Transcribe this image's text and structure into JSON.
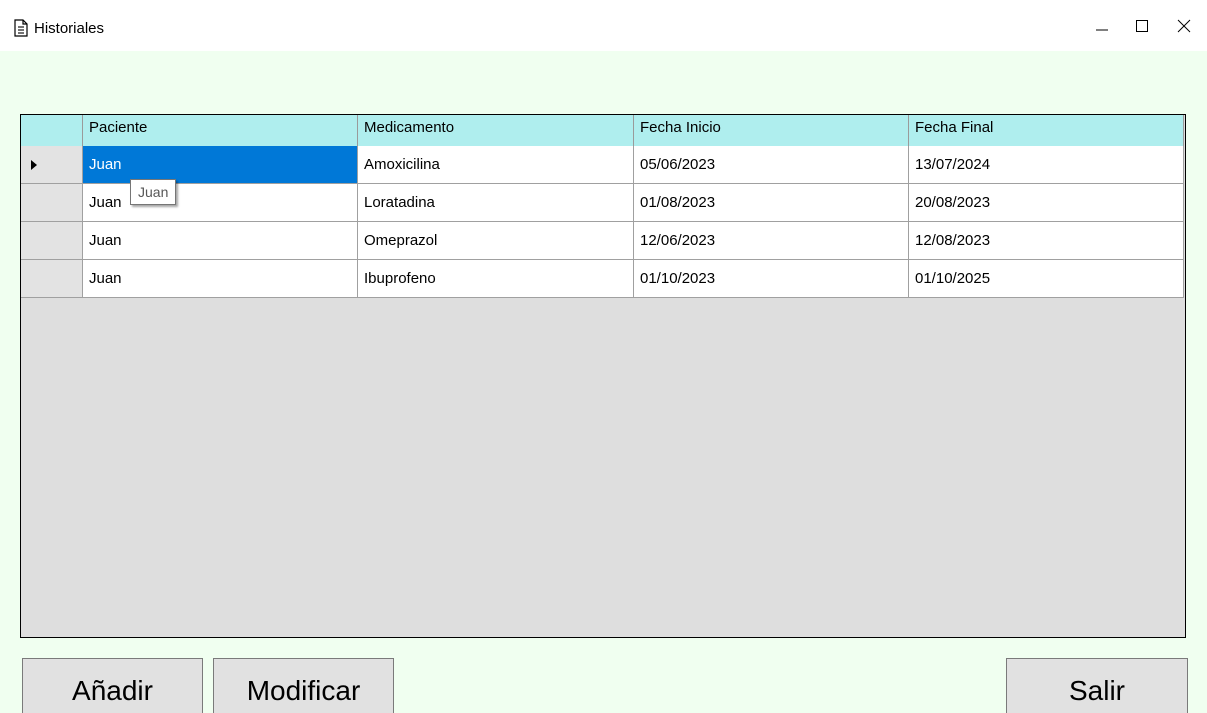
{
  "window": {
    "title": "Historiales",
    "app_icon": "document-icon",
    "controls": [
      "minimize-icon",
      "maximize-icon",
      "close-icon"
    ]
  },
  "grid": {
    "columns": [
      "Paciente",
      "Medicamento",
      "Fecha Inicio",
      "Fecha Final"
    ],
    "rows": [
      [
        "Juan",
        "Amoxicilina",
        "05/06/2023",
        "13/07/2024"
      ],
      [
        "Juan",
        "Loratadina",
        "01/08/2023",
        "20/08/2023"
      ],
      [
        "Juan",
        "Omeprazol",
        "12/06/2023",
        "12/08/2023"
      ],
      [
        "Juan",
        "Ibuprofeno",
        "01/10/2023",
        "01/10/2025"
      ]
    ],
    "current_row_marker": "row-arrow-icon",
    "tooltip": "Juan"
  },
  "buttons": {
    "add": "Añadir",
    "modify": "Modificar",
    "exit": "Salir"
  },
  "colors": {
    "header_bg": "#afeeee",
    "selection_bg": "#0078d7",
    "client_bg": "#f0fff0",
    "grid_empty_bg": "#dedede"
  }
}
